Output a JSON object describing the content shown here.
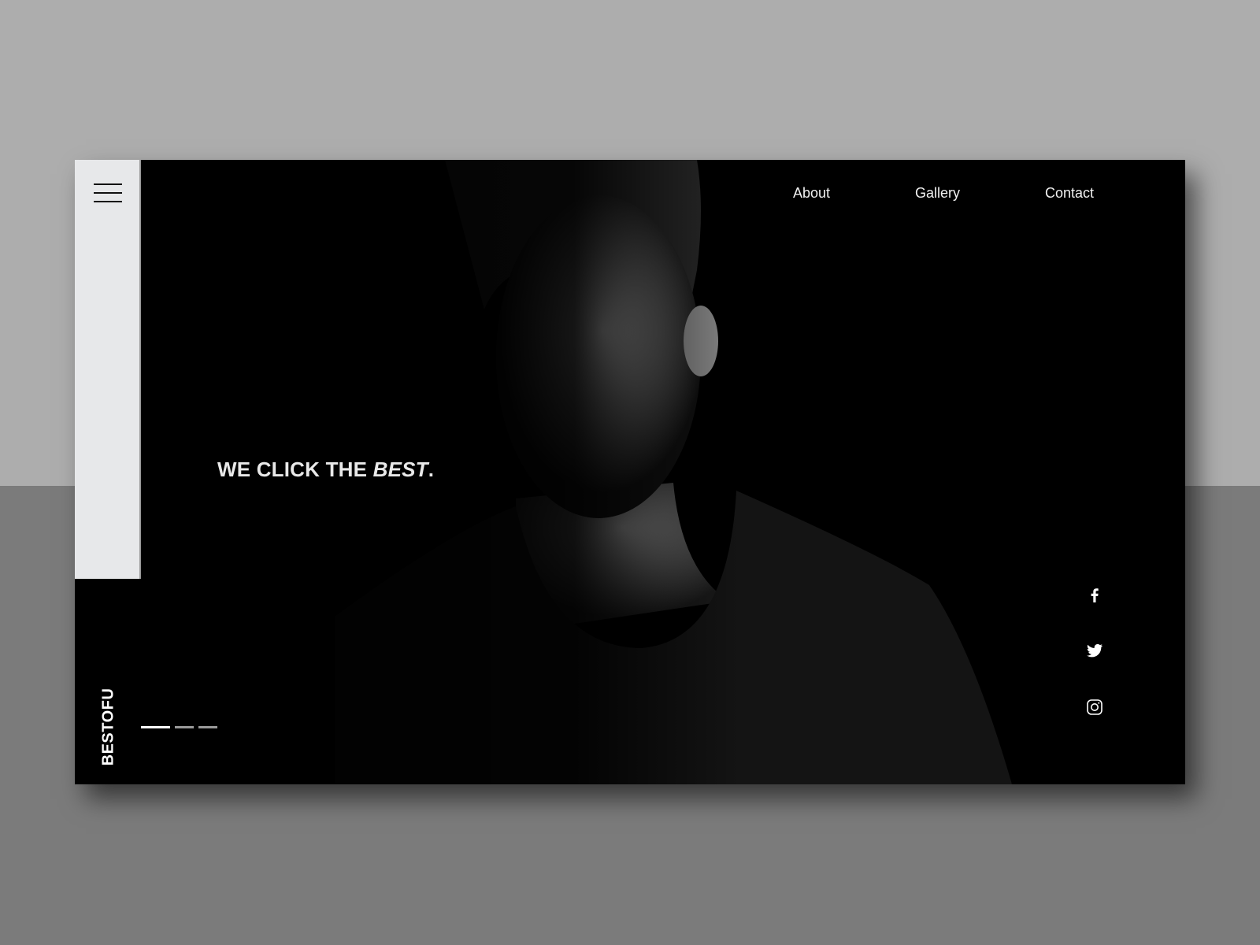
{
  "menu": {
    "icon": "hamburger-menu-icon"
  },
  "nav": {
    "items": [
      {
        "label": "About"
      },
      {
        "label": "Gallery"
      },
      {
        "label": "Contact"
      }
    ]
  },
  "hero": {
    "headline_prefix": "WE CLICK THE ",
    "headline_emphasis": "BEST",
    "headline_suffix": ".",
    "image": "portrait-photo"
  },
  "brand": {
    "name": "BESTOFU"
  },
  "pager": {
    "total": 3,
    "active": 1
  },
  "social": [
    {
      "icon": "facebook-icon"
    },
    {
      "icon": "twitter-icon"
    },
    {
      "icon": "instagram-icon"
    }
  ],
  "colors": {
    "background_top": "#adadad",
    "background_bottom": "#7b7b7b",
    "card": "#000000",
    "sidebar": "#e7e8ea",
    "text": "#f2f2f2"
  }
}
